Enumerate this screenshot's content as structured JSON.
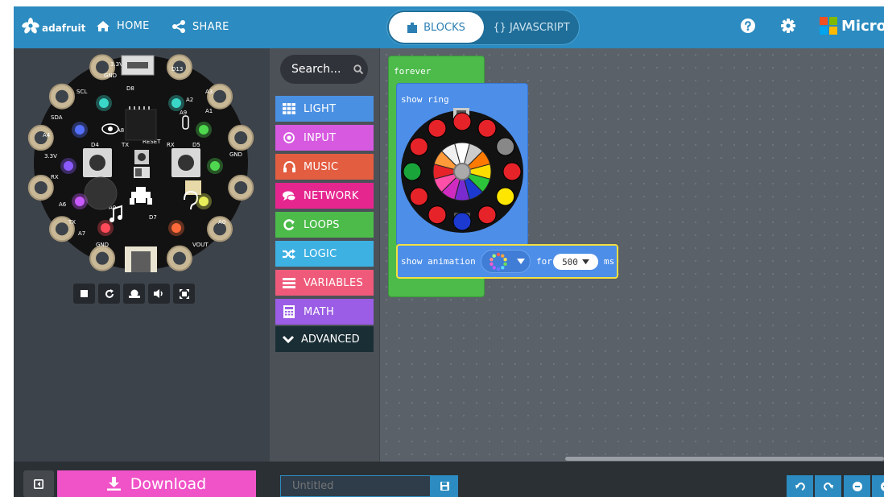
{
  "header": {
    "brand": "adafruit",
    "home_label": "HOME",
    "share_label": "SHARE",
    "blocks_label": "BLOCKS",
    "javascript_label": "{} JAVASCRIPT",
    "microsoft_label": "Micros",
    "color": "#2c8bc0"
  },
  "toolbox": {
    "search_label": "Search...",
    "categories": [
      {
        "label": "LIGHT",
        "color": "#4a90e2",
        "icon": "grid-icon"
      },
      {
        "label": "INPUT",
        "color": "#d659e0",
        "icon": "target-icon"
      },
      {
        "label": "MUSIC",
        "color": "#e35d41",
        "icon": "headphones-icon"
      },
      {
        "label": "NETWORK",
        "color": "#e6268f",
        "icon": "chat-icon"
      },
      {
        "label": "LOOPS",
        "color": "#4cbb4a",
        "icon": "loop-icon"
      },
      {
        "label": "LOGIC",
        "color": "#3eb1e3",
        "icon": "shuffle-icon"
      },
      {
        "label": "VARIABLES",
        "color": "#ef5a7a",
        "icon": "list-icon"
      },
      {
        "label": "MATH",
        "color": "#9b5de5",
        "icon": "calculator-icon"
      }
    ],
    "advanced_label": "ADVANCED"
  },
  "blocks": {
    "forever_label": "forever",
    "show_ring_label": "show ring",
    "ring_colors": [
      "#e52329",
      "#e52329",
      "#e52329",
      "#888888",
      "#e52329",
      "#ffe600",
      "#e52329",
      "#1c3ad0",
      "#e52329",
      "#e52329",
      "#1aa53a",
      "#e52329"
    ],
    "show_animation_label": "show animation",
    "for_label": "for",
    "duration_value": "500",
    "unit_label": "ms"
  },
  "simulator": {
    "board_labels": [
      "GND",
      "D13",
      "3.3V",
      "D8",
      "SCL",
      "A3",
      "A1",
      "A2",
      "SDA",
      "A4",
      "D4",
      "TX",
      "RESET",
      "RX",
      "D5",
      "GND",
      "RX",
      "A6",
      "TX",
      "A7",
      "A0",
      "D7",
      "GND",
      "VOUT",
      "A8",
      "A9",
      "3.3V",
      "A0"
    ]
  },
  "bottom": {
    "download_label": "Download",
    "project_placeholder": "Untitled",
    "download_color": "#f053c8"
  }
}
